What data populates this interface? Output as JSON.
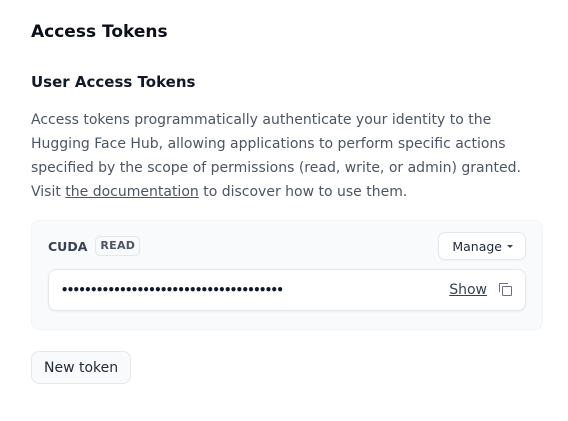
{
  "page": {
    "title": "Access Tokens"
  },
  "section": {
    "title": "User Access Tokens",
    "description_before_link": "Access tokens programmatically authenticate your identity to the Hugging Face Hub, allowing applications to perform specific actions specified by the scope of permissions (read, write, or admin) granted. Visit ",
    "link_text": "the documentation",
    "description_after_link": " to discover how to use them."
  },
  "token": {
    "name": "CUDA",
    "role": "READ",
    "manage_label": "Manage",
    "masked_value": "••••••••••••••••••••••••••••••••••••••",
    "show_label": "Show",
    "copy_icon": "copy-icon"
  },
  "actions": {
    "new_token_label": "New token"
  }
}
